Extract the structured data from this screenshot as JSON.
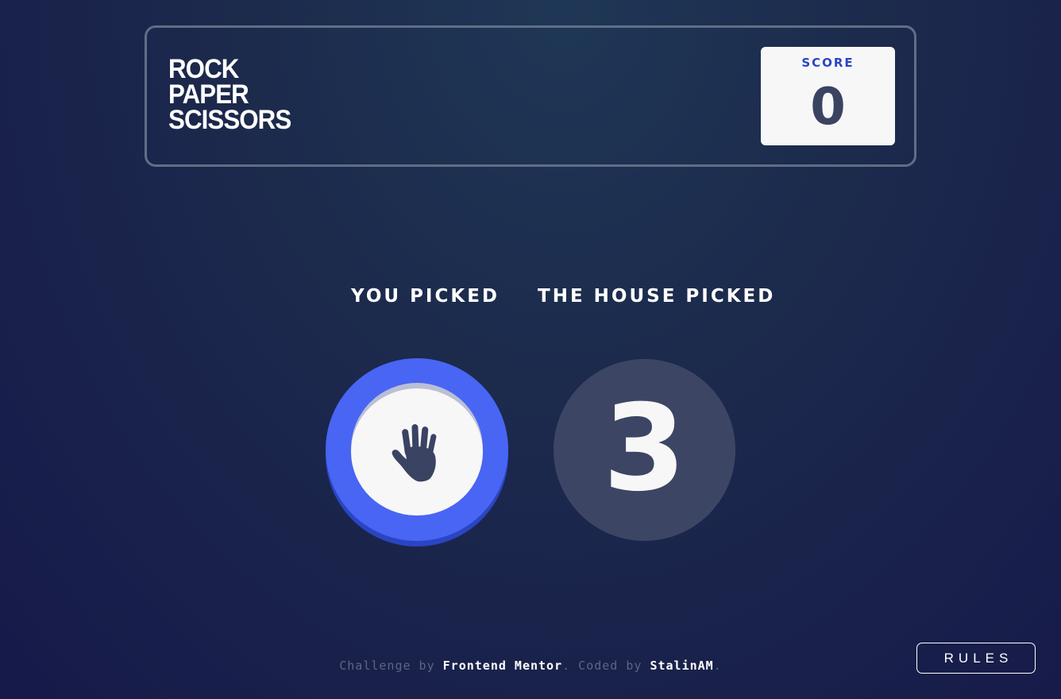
{
  "header": {
    "title_lines": [
      "ROCK",
      "PAPER",
      "SCISSORS"
    ],
    "score_label": "SCORE",
    "score_value": "0"
  },
  "game": {
    "you_picked_label": "YOU PICKED",
    "house_picked_label": "THE HOUSE PICKED",
    "player_choice": "paper",
    "player_choice_icon": "paper-hand-icon",
    "house_countdown": "3",
    "colors": {
      "paper_ring": "#4865f4",
      "paper_ring_shadow": "#2a45c2",
      "house_placeholder": "#3d4565"
    }
  },
  "footer": {
    "challenge_prefix": "Challenge by ",
    "challenge_author": "Frontend Mentor",
    "coded_prefix": ". Coded by ",
    "coded_author": "StalinAM",
    "suffix": "."
  },
  "rules_button": "RULES"
}
